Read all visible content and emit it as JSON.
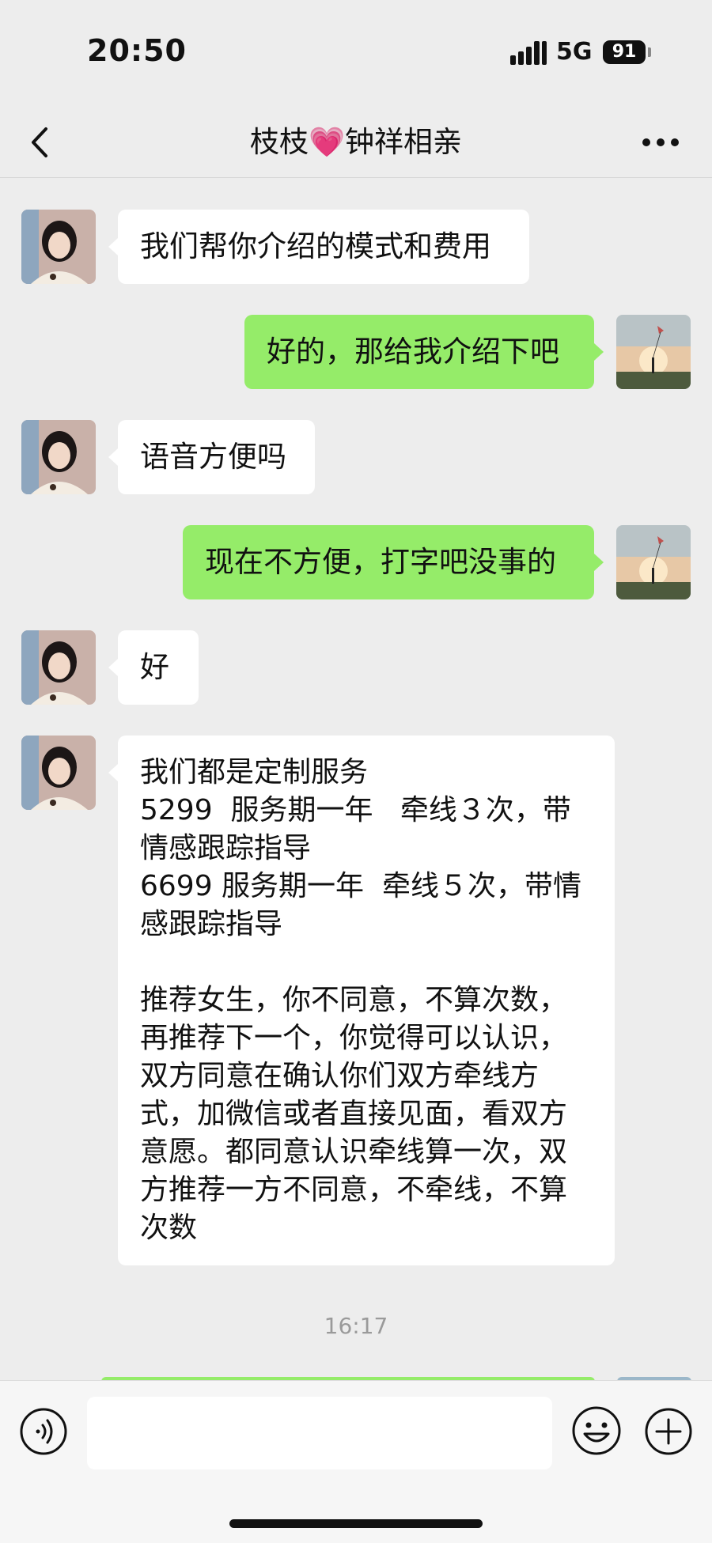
{
  "status_bar": {
    "time": "20:50",
    "network": "5G",
    "battery": "91"
  },
  "header": {
    "title": "枝枝💗钟祥相亲"
  },
  "icons": {
    "back": "chevron-left-icon",
    "more": "more-horizontal-icon",
    "voice": "voice-icon",
    "emoji": "emoji-icon",
    "plus": "plus-icon"
  },
  "colors": {
    "background": "#ededed",
    "outgoing_bubble": "#95ec69",
    "incoming_bubble": "#ffffff"
  },
  "messages": [
    {
      "sender": "contact",
      "text": "我们帮你介绍的模式和费用"
    },
    {
      "sender": "me",
      "text": "好的，那给我介绍下吧"
    },
    {
      "sender": "contact",
      "text": "语音方便吗"
    },
    {
      "sender": "me",
      "text": "现在不方便，打字吧没事的"
    },
    {
      "sender": "contact",
      "text": "好"
    },
    {
      "sender": "contact",
      "text": "我们都是定制服务\n5299  服务期一年   牵线３次，带情感跟踪指导\n6699 服务期一年  牵线５次，带情感跟踪指导\n\n推荐女生，你不同意，不算次数，再推荐下一个，你觉得可以认识，双方同意在确认你们双方牵线方式，加微信或者直接见面，看双方意愿。都同意认识牵线算一次，双方推荐一方不同意，不牵线，不算次数"
    }
  ],
  "timestamp": "16:17",
  "composer": {
    "value": ""
  }
}
